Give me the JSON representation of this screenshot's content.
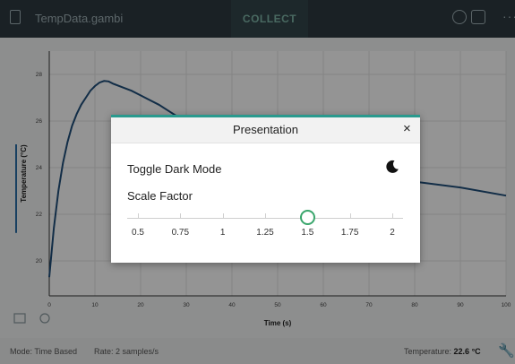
{
  "topbar": {
    "filename": "TempData.gambi",
    "collect_label": "COLLECT",
    "more_label": "···"
  },
  "chart_data": {
    "type": "line",
    "xlabel": "Time (s)",
    "ylabel": "Temperature (°C)",
    "xlim": [
      0,
      100
    ],
    "ylim": [
      18.5,
      29
    ],
    "xticks": [
      0,
      10,
      20,
      30,
      40,
      50,
      60,
      70,
      80,
      90,
      100
    ],
    "yticks": [
      20,
      22,
      24,
      26,
      28
    ],
    "grid": true,
    "series": [
      {
        "color": "#1f4f7a",
        "x": [
          0,
          1,
          2,
          3,
          4,
          5,
          6,
          7,
          8,
          9,
          10,
          11,
          12,
          13,
          14,
          16,
          18,
          20,
          22,
          24,
          26,
          28,
          30,
          40,
          50,
          60,
          70,
          80,
          90,
          100
        ],
        "y": [
          19.3,
          21.4,
          23.0,
          24.2,
          25.1,
          25.8,
          26.3,
          26.7,
          27.0,
          27.3,
          27.5,
          27.65,
          27.72,
          27.7,
          27.6,
          27.45,
          27.3,
          27.1,
          26.9,
          26.7,
          26.45,
          26.2,
          25.95,
          25.2,
          24.5,
          24.0,
          23.6,
          23.4,
          23.15,
          22.8
        ]
      }
    ]
  },
  "status": {
    "mode": "Mode: Time Based",
    "rate": "Rate: 2 samples/s",
    "temp_label": "Temperature:",
    "temp_value": "22.6 °C"
  },
  "dialog": {
    "title": "Presentation",
    "close_label": "×",
    "dark_mode_label": "Toggle Dark Mode",
    "scale_label": "Scale Factor",
    "scale_options": [
      "0.5",
      "0.75",
      "1",
      "1.25",
      "1.5",
      "1.75",
      "2"
    ],
    "scale_selected": "1.5",
    "accent_color": "#2a9a8e",
    "thumb_color": "#3aa66c"
  }
}
